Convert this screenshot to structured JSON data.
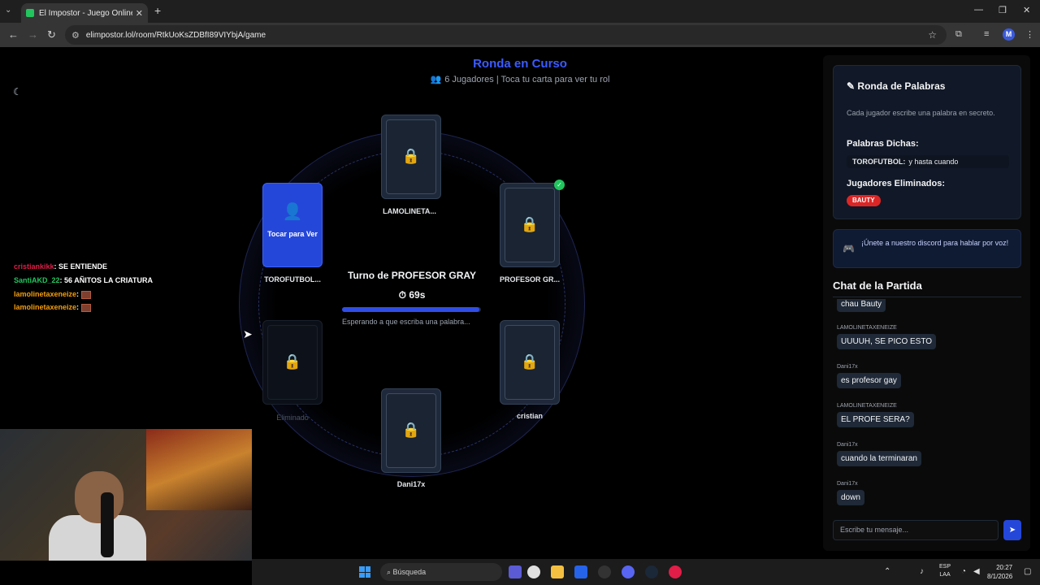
{
  "browser": {
    "tab_title": "El Impostor - Juego Online para",
    "url": "elimpostor.lol/room/RtkUoKsZDBfI89VIYbjA/game",
    "profile_initial": "M"
  },
  "header": {
    "title": "Ronda en Curso",
    "subtitle": "6 Jugadores | Toca tu carta para ver tu rol"
  },
  "players": [
    {
      "name": "LAMOLINETA...",
      "state": "locked"
    },
    {
      "name": "TOROFUTBOL...",
      "state": "me",
      "tap_label": "Tocar para Ver"
    },
    {
      "name": "PROFESOR GR...",
      "state": "locked",
      "done": true
    },
    {
      "name": "Eliminado",
      "state": "eliminated"
    },
    {
      "name": "cristian",
      "state": "locked"
    },
    {
      "name": "Dani17x",
      "state": "locked"
    }
  ],
  "turn": {
    "label": "Turno de PROFESOR GRAY",
    "timer": "69s",
    "progress": 0.99,
    "waiting": "Esperando a que escriba una palabra..."
  },
  "stream_chat": [
    {
      "user": "cristiankikk",
      "text": ": SE ENTIENDE",
      "color": "u1"
    },
    {
      "user": "SantiAKD_22",
      "text": ": 56 AÑITOS LA CRIATURA",
      "color": "u2"
    },
    {
      "user": "lamolinetaxeneize",
      "text": ":",
      "color": "u3"
    },
    {
      "user": "lamolinetaxeneize",
      "text": ":",
      "color": "u3"
    }
  ],
  "sidebar": {
    "words_title": "Ronda de Palabras",
    "words_desc": "Cada jugador escribe una palabra en secreto.",
    "said_label": "Palabras Dichas:",
    "said_player": "TOROFUTBOL:",
    "said_word": "y hasta cuando",
    "eliminated_label": "Jugadores Eliminados:",
    "eliminated_player": "BAUTY",
    "discord_text": "¡Únete a nuestro discord para hablar por voz!",
    "chat_title": "Chat de la Partida",
    "messages": [
      {
        "author": "",
        "text": "chau Bauty"
      },
      {
        "author": "LAMOLINETAXENEIZE",
        "text": "UUUUH, SE PICO ESTO"
      },
      {
        "author": "Dani17x",
        "text": "es profesor gay"
      },
      {
        "author": "LAMOLINETAXENEIZE",
        "text": "EL PROFE SERA?"
      },
      {
        "author": "Dani17x",
        "text": "cuando la terminaran"
      },
      {
        "author": "Dani17x",
        "text": "down"
      }
    ],
    "input_placeholder": "Escribe tu mensaje..."
  },
  "taskbar": {
    "search": "Búsqueda",
    "lang1": "ESP",
    "lang2": "LAA",
    "time": "20:27",
    "date": "8/1/2026"
  },
  "colors": {
    "accent": "#2547d9",
    "title": "#3b5bff",
    "badge": "#dc2626",
    "check": "#22c55e"
  }
}
